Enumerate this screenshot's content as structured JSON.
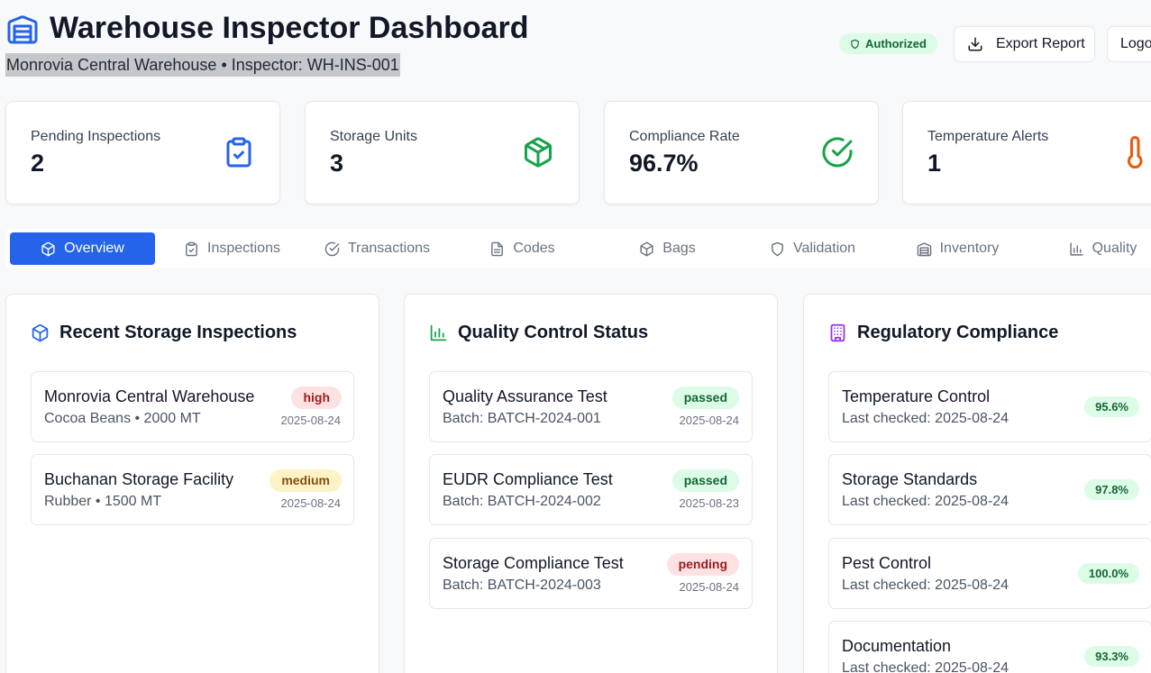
{
  "header": {
    "title": "Warehouse Inspector Dashboard",
    "subtitle": "Monrovia Central Warehouse • Inspector: WH-INS-001",
    "auth_badge": "Authorized",
    "export_label": "Export Report",
    "logout_label": "Logo"
  },
  "stats": [
    {
      "label": "Pending Inspections",
      "value": "2",
      "icon": "clipboard-check-icon",
      "color": "#2563eb"
    },
    {
      "label": "Storage Units",
      "value": "3",
      "icon": "package-icon",
      "color": "#16a34a"
    },
    {
      "label": "Compliance Rate",
      "value": "96.7%",
      "icon": "check-circle-icon",
      "color": "#16a34a"
    },
    {
      "label": "Temperature Alerts",
      "value": "1",
      "icon": "thermometer-icon",
      "color": "#ea580c"
    }
  ],
  "tabs": [
    {
      "label": "Overview",
      "icon": "package-icon",
      "active": true
    },
    {
      "label": "Inspections",
      "icon": "clipboard-icon"
    },
    {
      "label": "Transactions",
      "icon": "check-circle-icon"
    },
    {
      "label": "Codes",
      "icon": "file-text-icon"
    },
    {
      "label": "Bags",
      "icon": "package-icon"
    },
    {
      "label": "Validation",
      "icon": "shield-icon"
    },
    {
      "label": "Inventory",
      "icon": "warehouse-icon"
    },
    {
      "label": "Quality",
      "icon": "bar-chart-icon"
    }
  ],
  "inspections_panel": {
    "title": "Recent Storage Inspections",
    "items": [
      {
        "name": "Monrovia Central Warehouse",
        "detail": "Cocoa Beans • 2000 MT",
        "priority": "high",
        "date": "2025-08-24"
      },
      {
        "name": "Buchanan Storage Facility",
        "detail": "Rubber • 1500 MT",
        "priority": "medium",
        "date": "2025-08-24"
      }
    ]
  },
  "quality_panel": {
    "title": "Quality Control Status",
    "items": [
      {
        "name": "Quality Assurance Test",
        "detail": "Batch: BATCH-2024-001",
        "status": "passed",
        "date": "2025-08-24"
      },
      {
        "name": "EUDR Compliance Test",
        "detail": "Batch: BATCH-2024-002",
        "status": "passed",
        "date": "2025-08-23"
      },
      {
        "name": "Storage Compliance Test",
        "detail": "Batch: BATCH-2024-003",
        "status": "pending",
        "date": "2025-08-24"
      }
    ]
  },
  "compliance_panel": {
    "title": "Regulatory Compliance",
    "items": [
      {
        "name": "Temperature Control",
        "detail": "Last checked: 2025-08-24",
        "score": "95.6%"
      },
      {
        "name": "Storage Standards",
        "detail": "Last checked: 2025-08-24",
        "score": "97.8%"
      },
      {
        "name": "Pest Control",
        "detail": "Last checked: 2025-08-24",
        "score": "100.0%"
      },
      {
        "name": "Documentation",
        "detail": "Last checked: 2025-08-24",
        "score": "93.3%"
      }
    ]
  }
}
